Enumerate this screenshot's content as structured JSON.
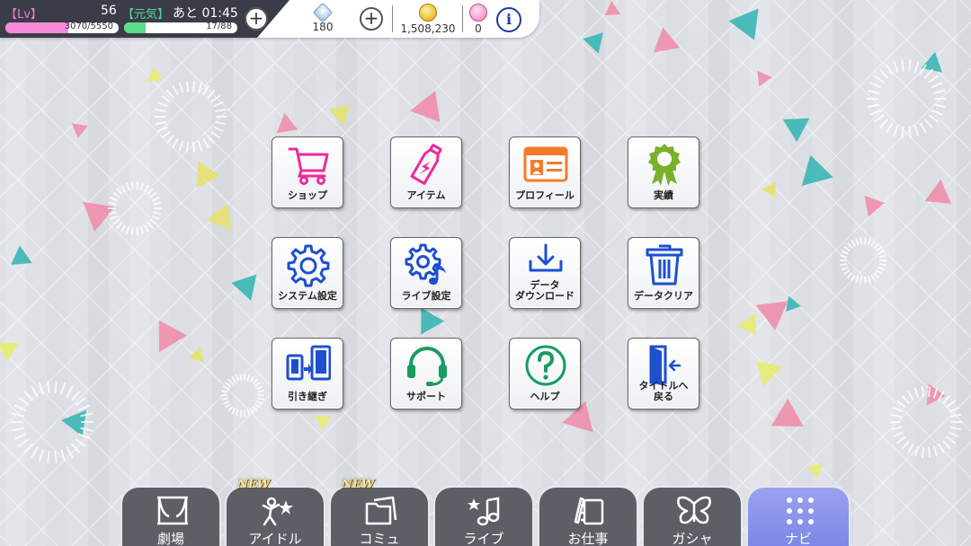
{
  "status": {
    "level_tag": "【Lv】",
    "level": "56",
    "genki_tag": "【元気】",
    "recover_label": "あと 01:45",
    "exp_text": "3070/5550",
    "exp_fraction": 0.553,
    "stamina_text": "17/88",
    "stamina_fraction": 0.193
  },
  "resources": {
    "jewels": "180",
    "coins": "1,508,230",
    "tickets": "0"
  },
  "menu": [
    {
      "label": "ショップ",
      "icon": "cart-icon"
    },
    {
      "label": "アイテム",
      "icon": "drink-bottle-icon"
    },
    {
      "label": "プロフィール",
      "icon": "id-card-icon"
    },
    {
      "label": "実績",
      "icon": "award-ribbon-icon"
    },
    {
      "label": "システム設定",
      "icon": "gear-icon"
    },
    {
      "label": "ライブ設定",
      "icon": "gear-music-icon"
    },
    {
      "label": "データ\nダウンロード",
      "icon": "download-icon"
    },
    {
      "label": "データクリア",
      "icon": "trash-icon"
    },
    {
      "label": "引き継ぎ",
      "icon": "device-transfer-icon"
    },
    {
      "label": "サポート",
      "icon": "headset-icon"
    },
    {
      "label": "ヘルプ",
      "icon": "help-icon"
    },
    {
      "label": "タイトルへ\n戻る",
      "icon": "exit-door-icon"
    }
  ],
  "nav": [
    {
      "label": "劇場",
      "icon": "theater-icon"
    },
    {
      "label": "アイドル",
      "icon": "idol-icon",
      "badge": "NEW"
    },
    {
      "label": "コミュ",
      "icon": "commu-icon",
      "badge": "NEW"
    },
    {
      "label": "ライブ",
      "icon": "music-notes-icon"
    },
    {
      "label": "お仕事",
      "icon": "work-icon"
    },
    {
      "label": "ガシャ",
      "icon": "butterfly-icon"
    },
    {
      "label": "ナビ",
      "icon": "dots-grid-icon"
    }
  ],
  "colors": {
    "exp_fill": "#f58ad8",
    "stamina_fill": "#5ddc8c",
    "nav_active": "#8b94ec",
    "icon_pink": "#ee2a9c",
    "icon_orange": "#f57b28",
    "icon_green": "#7ab12a",
    "icon_blue": "#1d4fcf",
    "icon_teal": "#1a9b62"
  }
}
